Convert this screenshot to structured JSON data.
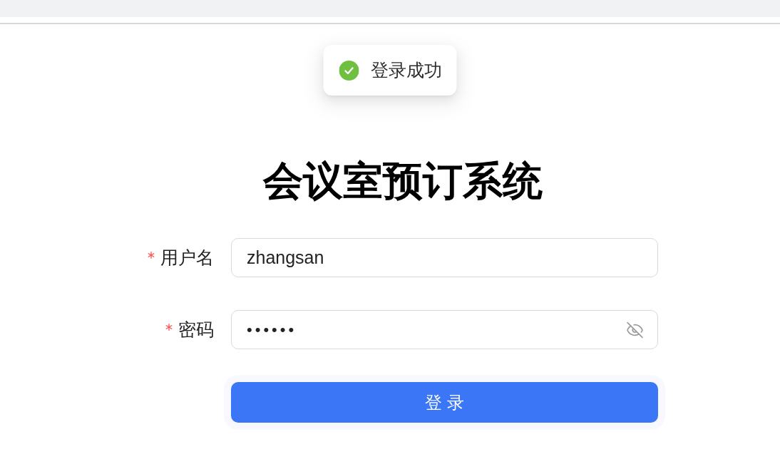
{
  "toast": {
    "kind": "success",
    "text": "登录成功"
  },
  "title": "会议室预订系统",
  "form": {
    "fields": [
      {
        "kind": "text",
        "label": "用户名",
        "required": true,
        "value": "zhangsan"
      },
      {
        "kind": "password",
        "label": "密码",
        "required": true,
        "value": "••••••",
        "revealed": false
      }
    ],
    "submit": {
      "label": "登 录"
    }
  }
}
